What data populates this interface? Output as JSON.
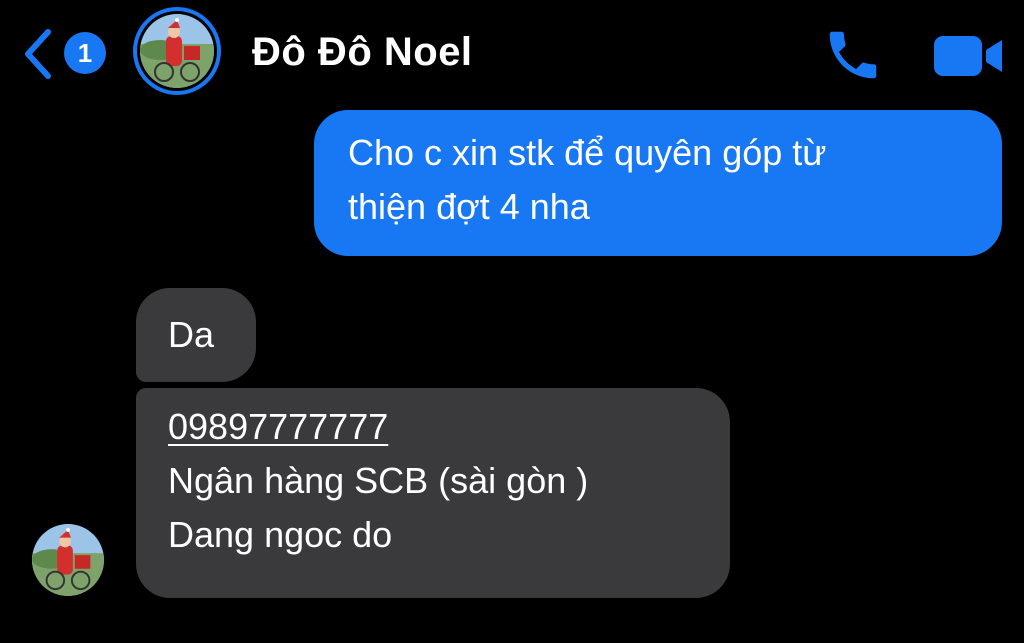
{
  "header": {
    "unread_count": "1",
    "contact_name": "Đô Đô Noel",
    "back_icon": "chevron-left-icon",
    "call_icon": "phone-icon",
    "video_icon": "video-camera-icon"
  },
  "colors": {
    "accent": "#1877f2",
    "background": "#000000",
    "incoming_bubble": "#3a3a3c",
    "text": "#ffffff"
  },
  "messages": [
    {
      "direction": "outgoing",
      "lines": [
        "Cho c xin stk để quyên góp từ",
        "thiện đợt 4 nha"
      ]
    },
    {
      "direction": "incoming",
      "lines": [
        "Da"
      ]
    },
    {
      "direction": "incoming",
      "phone": "09897777777",
      "lines": [
        "Ngân hàng SCB (sài gòn )",
        "Dang ngoc do"
      ]
    }
  ]
}
